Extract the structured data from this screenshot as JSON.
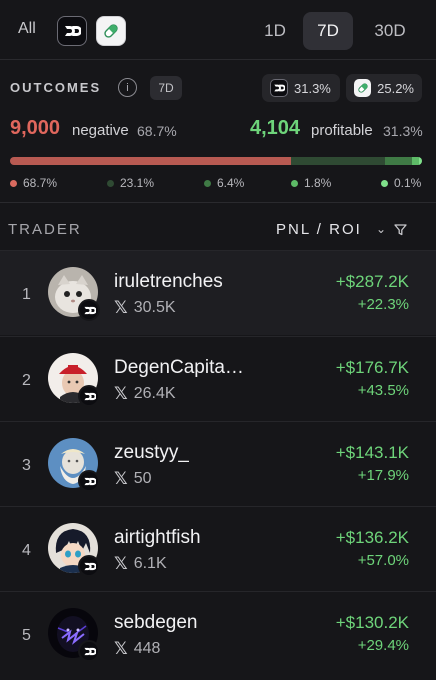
{
  "filters": {
    "all_label": "All",
    "periods": [
      "1D",
      "7D",
      "30D"
    ],
    "selected_period": "7D"
  },
  "outcomes": {
    "title": "OUTCOMES",
    "info_label": "i",
    "period_label": "7D",
    "shares": [
      "31.3%",
      "25.2%"
    ],
    "negative": {
      "count": "9,000",
      "label": "negative",
      "pct": "68.7%"
    },
    "profitable": {
      "count": "4,104",
      "label": "profitable",
      "pct": "31.3%"
    },
    "distribution": [
      {
        "label": "68.7%",
        "value": 68.7,
        "color": "#b85a52"
      },
      {
        "label": "23.1%",
        "value": 23.1,
        "color": "#2f4a33"
      },
      {
        "label": "6.4%",
        "value": 6.4,
        "color": "#3f7a45"
      },
      {
        "label": "1.8%",
        "value": 1.8,
        "color": "#5dbb67"
      },
      {
        "label": "0.1%",
        "value": 0.1,
        "color": "#7fe08a"
      }
    ]
  },
  "table": {
    "col_trader": "TRADER",
    "col_pnl": "PNL / ROI",
    "rows": [
      {
        "rank": "1",
        "name": "iruletrenches",
        "followers": "30.5K",
        "pnl": "+$287.2K",
        "roi": "+22.3%"
      },
      {
        "rank": "2",
        "name": "DegenCapita…",
        "followers": "26.4K",
        "pnl": "+$176.7K",
        "roi": "+43.5%"
      },
      {
        "rank": "3",
        "name": "zeustyy_",
        "followers": "50",
        "pnl": "+$143.1K",
        "roi": "+17.9%"
      },
      {
        "rank": "4",
        "name": "airtightfish",
        "followers": "6.1K",
        "pnl": "+$136.2K",
        "roi": "+57.0%"
      },
      {
        "rank": "5",
        "name": "sebdegen",
        "followers": "448",
        "pnl": "+$130.2K",
        "roi": "+29.4%"
      }
    ]
  },
  "icons": {
    "x_glyph": "𝕏"
  },
  "colors": {
    "negative": "#e0675d",
    "positive": "#6ed47a"
  }
}
